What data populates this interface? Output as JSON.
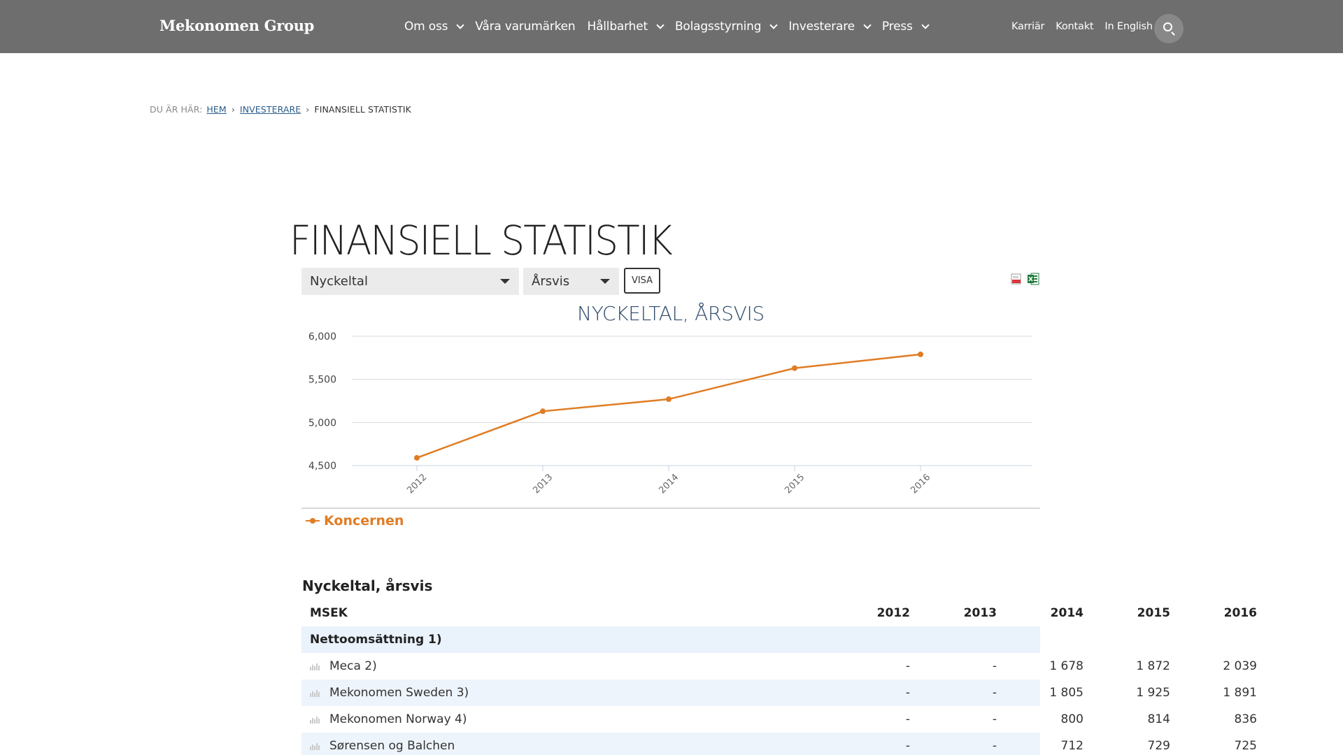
{
  "header": {
    "logo": "Mekonomen Group",
    "nav": [
      {
        "label": "Om oss",
        "has_dropdown": true
      },
      {
        "label": "Våra varumärken",
        "has_dropdown": false
      },
      {
        "label": "Hållbarhet",
        "has_dropdown": true
      },
      {
        "label": "Bolagsstyrning",
        "has_dropdown": true
      },
      {
        "label": "Investerare",
        "has_dropdown": true
      },
      {
        "label": "Press",
        "has_dropdown": true
      }
    ],
    "utility": [
      "Karriär",
      "Kontakt",
      "In English"
    ],
    "search_icon": "search-icon"
  },
  "breadcrumb": {
    "prefix": "DU ÄR HÄR:",
    "links": [
      "HEM",
      "INVESTERARE"
    ],
    "current": "FINANSIELL STATISTIK"
  },
  "page": {
    "title": "FINANSIELL STATISTIK"
  },
  "controls": {
    "type_select": "Nyckeltal",
    "period_select": "Årsvis",
    "show_button": "VISA",
    "export_icons": [
      "pdf-export-icon",
      "excel-export-icon"
    ]
  },
  "chart_data": {
    "type": "line",
    "title": "NYCKELTAL, ÅRSVIS",
    "categories": [
      "2012",
      "2013",
      "2014",
      "2015",
      "2016"
    ],
    "series": [
      {
        "name": "Koncernen",
        "values": [
          4590,
          5130,
          5270,
          5630,
          5790
        ]
      }
    ],
    "ylim": [
      4500,
      6000
    ],
    "yticks": [
      4500,
      5000,
      5500,
      6000
    ],
    "ytick_labels": [
      "4,500",
      "5,000",
      "5,500",
      "6,000"
    ],
    "grid": true,
    "legend_position": "bottom-left",
    "series_color": "#e07c24"
  },
  "table": {
    "title": "Nyckeltal, årsvis",
    "columns": [
      "MSEK",
      "2012",
      "2013",
      "2014",
      "2015",
      "2016"
    ],
    "section": "Nettoomsättning 1)",
    "rows": [
      {
        "label": "Meca 2)",
        "values": [
          "-",
          "-",
          "1 678",
          "1 872",
          "2 039"
        ]
      },
      {
        "label": "Mekonomen Sweden 3)",
        "values": [
          "-",
          "-",
          "1 805",
          "1 925",
          "1 891"
        ]
      },
      {
        "label": "Mekonomen Norway 4)",
        "values": [
          "-",
          "-",
          "800",
          "814",
          "836"
        ]
      },
      {
        "label": "Sørensen og Balchen",
        "values": [
          "-",
          "-",
          "712",
          "729",
          "725"
        ]
      }
    ]
  }
}
